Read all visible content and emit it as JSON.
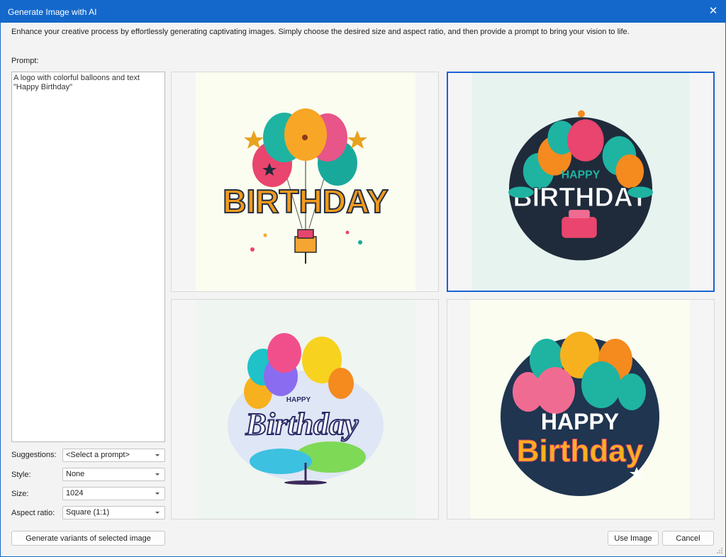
{
  "window": {
    "title": "Generate Image with AI",
    "close_glyph": "✕"
  },
  "description": "Enhance your creative process by effortlessly generating captivating images. Simply choose the desired size and aspect ratio, and then provide a prompt to bring your vision to life.",
  "prompt": {
    "label": "Prompt:",
    "value": "A logo with colorful balloons and text \"Happy Birthday\""
  },
  "settings": {
    "suggestions": {
      "label": "Suggestions:",
      "value": "<Select a prompt>"
    },
    "style": {
      "label": "Style:",
      "value": "None"
    },
    "size": {
      "label": "Size:",
      "value": "1024"
    },
    "aspect_ratio": {
      "label": "Aspect ratio:",
      "value": "Square (1:1)"
    }
  },
  "images": [
    {
      "id": "image-1",
      "caption": "BIRTHDAY",
      "selected": false,
      "bg": "#fbfdf1"
    },
    {
      "id": "image-2",
      "caption_top": "HAPPY",
      "caption": "BIRTHDAY",
      "selected": true,
      "bg": "#e6f3ef"
    },
    {
      "id": "image-3",
      "caption_top": "HAPPY",
      "caption": "Birthday",
      "selected": false,
      "bg": "#eff5f0"
    },
    {
      "id": "image-4",
      "caption_top": "HAPPY",
      "caption": "Birthday",
      "selected": false,
      "bg": "#fbfdf1"
    }
  ],
  "buttons": {
    "variants": "Generate variants of selected image",
    "use_image": "Use Image",
    "cancel": "Cancel"
  },
  "colors": {
    "accent": "#1468cb",
    "selection": "#1a62d6"
  }
}
